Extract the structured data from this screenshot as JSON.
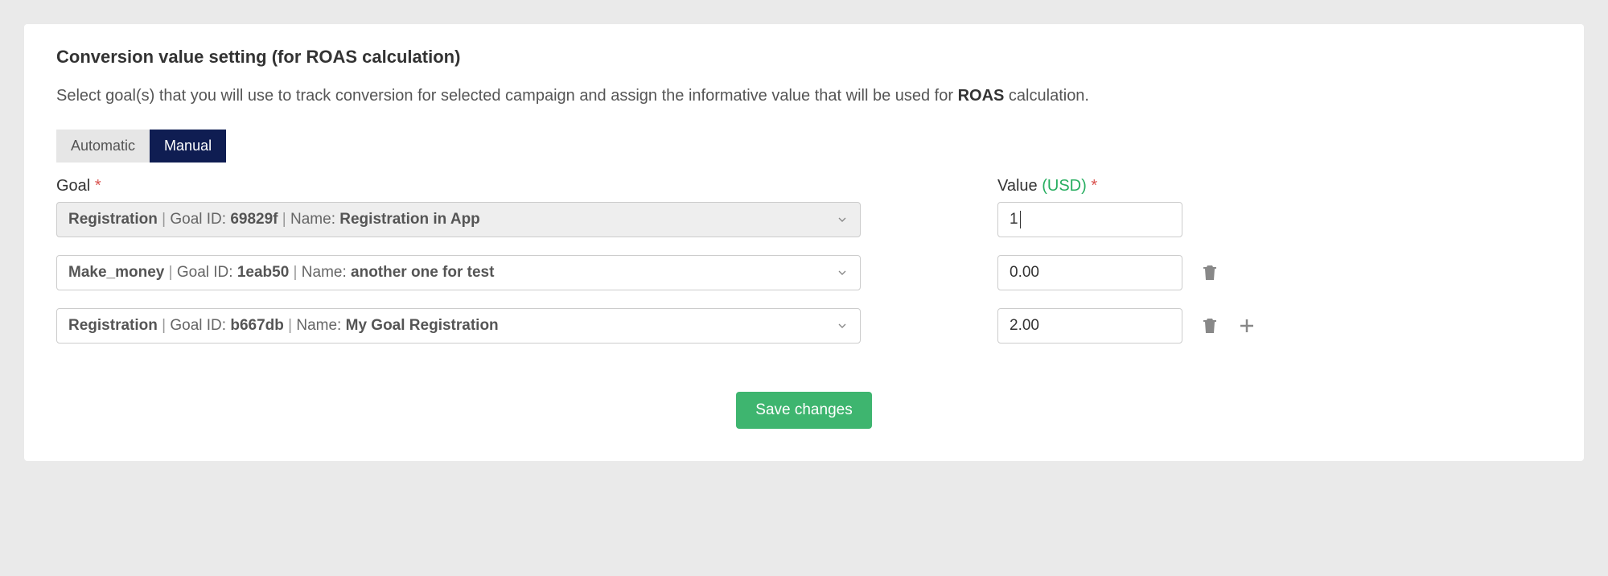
{
  "header": {
    "title": "Conversion value setting (for ROAS calculation)",
    "description_pre": "Select goal(s) that you will use to track conversion for selected campaign and assign the informative value that will be used for ",
    "description_bold": "ROAS",
    "description_post": " calculation."
  },
  "tabs": {
    "automatic": "Automatic",
    "manual": "Manual",
    "active": "manual"
  },
  "labels": {
    "goal": "Goal",
    "value": "Value",
    "currency": "(USD)",
    "required": "*",
    "goal_id_label": "Goal ID:",
    "name_label": "Name:",
    "separator": " | "
  },
  "rows": [
    {
      "goal_type": "Registration",
      "goal_id": "69829f",
      "goal_name": "Registration in App",
      "value": "1",
      "disabled": true,
      "editing": true,
      "has_delete": false,
      "has_add": false
    },
    {
      "goal_type": "Make_money",
      "goal_id": "1eab50",
      "goal_name": "another one for test",
      "value": "0.00",
      "disabled": false,
      "editing": false,
      "has_delete": true,
      "has_add": false
    },
    {
      "goal_type": "Registration",
      "goal_id": "b667db",
      "goal_name": "My Goal Registration",
      "value": "2.00",
      "disabled": false,
      "editing": false,
      "has_delete": true,
      "has_add": true
    }
  ],
  "buttons": {
    "save": "Save changes"
  },
  "colors": {
    "accent_navy": "#0f1d52",
    "accent_green": "#3eb56f",
    "required_red": "#d9534f",
    "currency_green": "#27ae60"
  }
}
